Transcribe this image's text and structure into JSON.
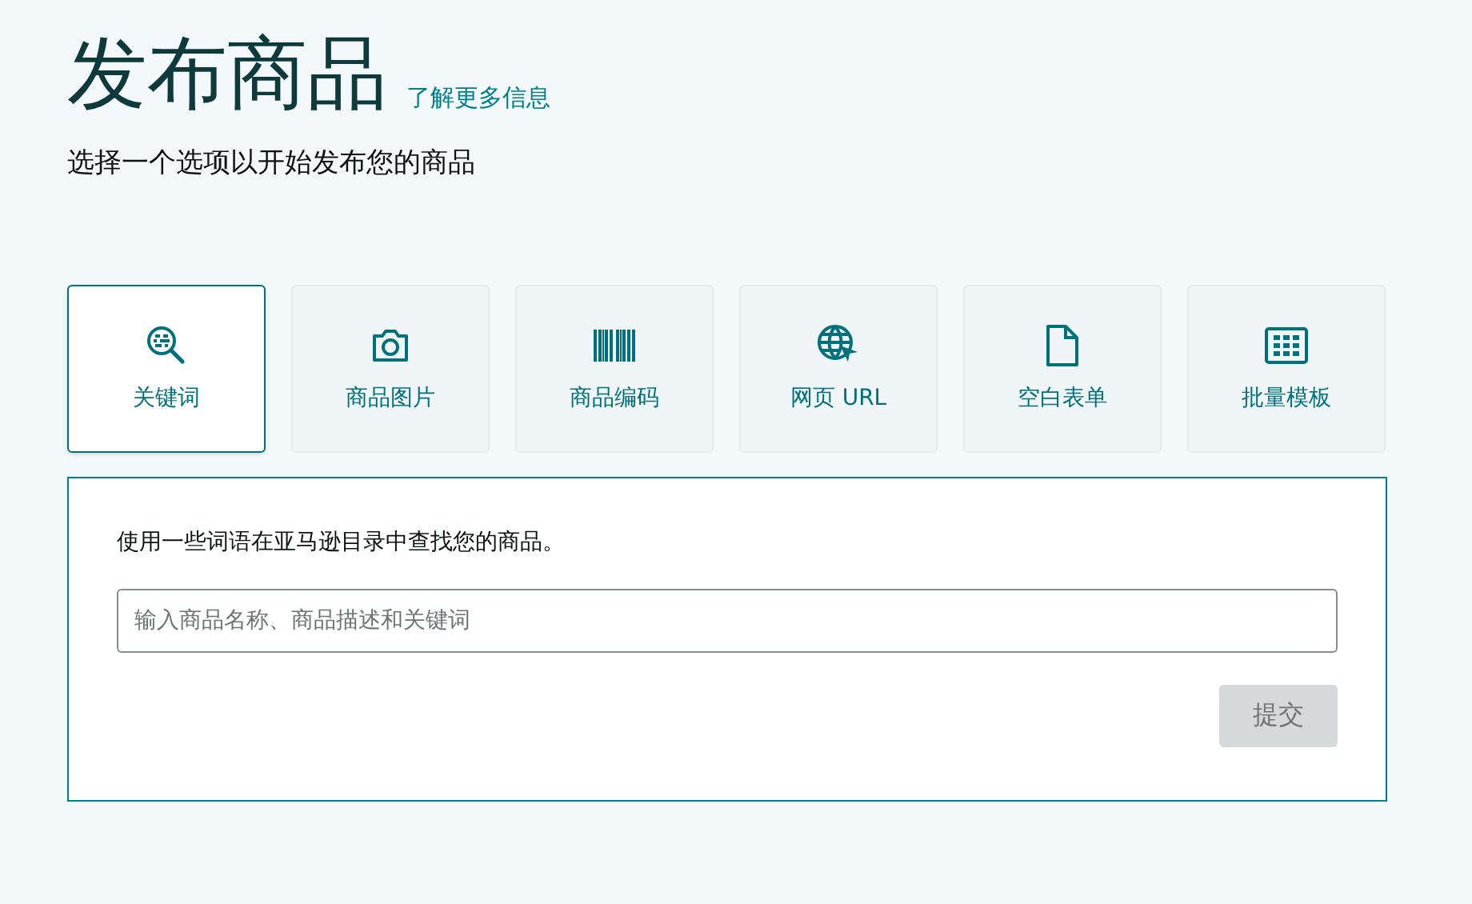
{
  "header": {
    "title": "发布商品",
    "learn_more_link": "了解更多信息",
    "subtitle": "选择一个选项以开始发布您的商品"
  },
  "options": [
    {
      "label": "关键词",
      "kind": "keyword",
      "selected": true
    },
    {
      "label": "商品图片",
      "kind": "camera",
      "selected": false
    },
    {
      "label": "商品编码",
      "kind": "barcode",
      "selected": false
    },
    {
      "label": "网页 URL",
      "kind": "web",
      "selected": false
    },
    {
      "label": "空白表单",
      "kind": "blank",
      "selected": false
    },
    {
      "label": "批量模板",
      "kind": "template",
      "selected": false
    }
  ],
  "panel": {
    "instruction": "使用一些词语在亚马逊目录中查找您的商品。",
    "search": {
      "placeholder": "输入商品名称、商品描述和关键词"
    },
    "submit": {
      "label": "提交",
      "disabled": true
    }
  }
}
